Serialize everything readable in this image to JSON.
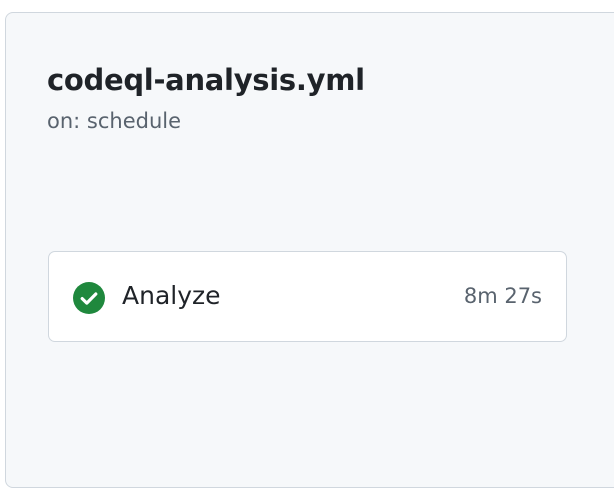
{
  "workflow": {
    "file_name": "codeql-analysis.yml",
    "trigger": "on: schedule"
  },
  "jobs": [
    {
      "name": "Analyze",
      "duration": "8m 27s",
      "status": "success",
      "status_icon": "check-circle-fill-icon",
      "status_color": "#1f883d"
    }
  ],
  "colors": {
    "panel_background": "#f6f8fa",
    "border": "#d0d7de",
    "text_primary": "#1f2328",
    "text_muted": "#59636e"
  }
}
